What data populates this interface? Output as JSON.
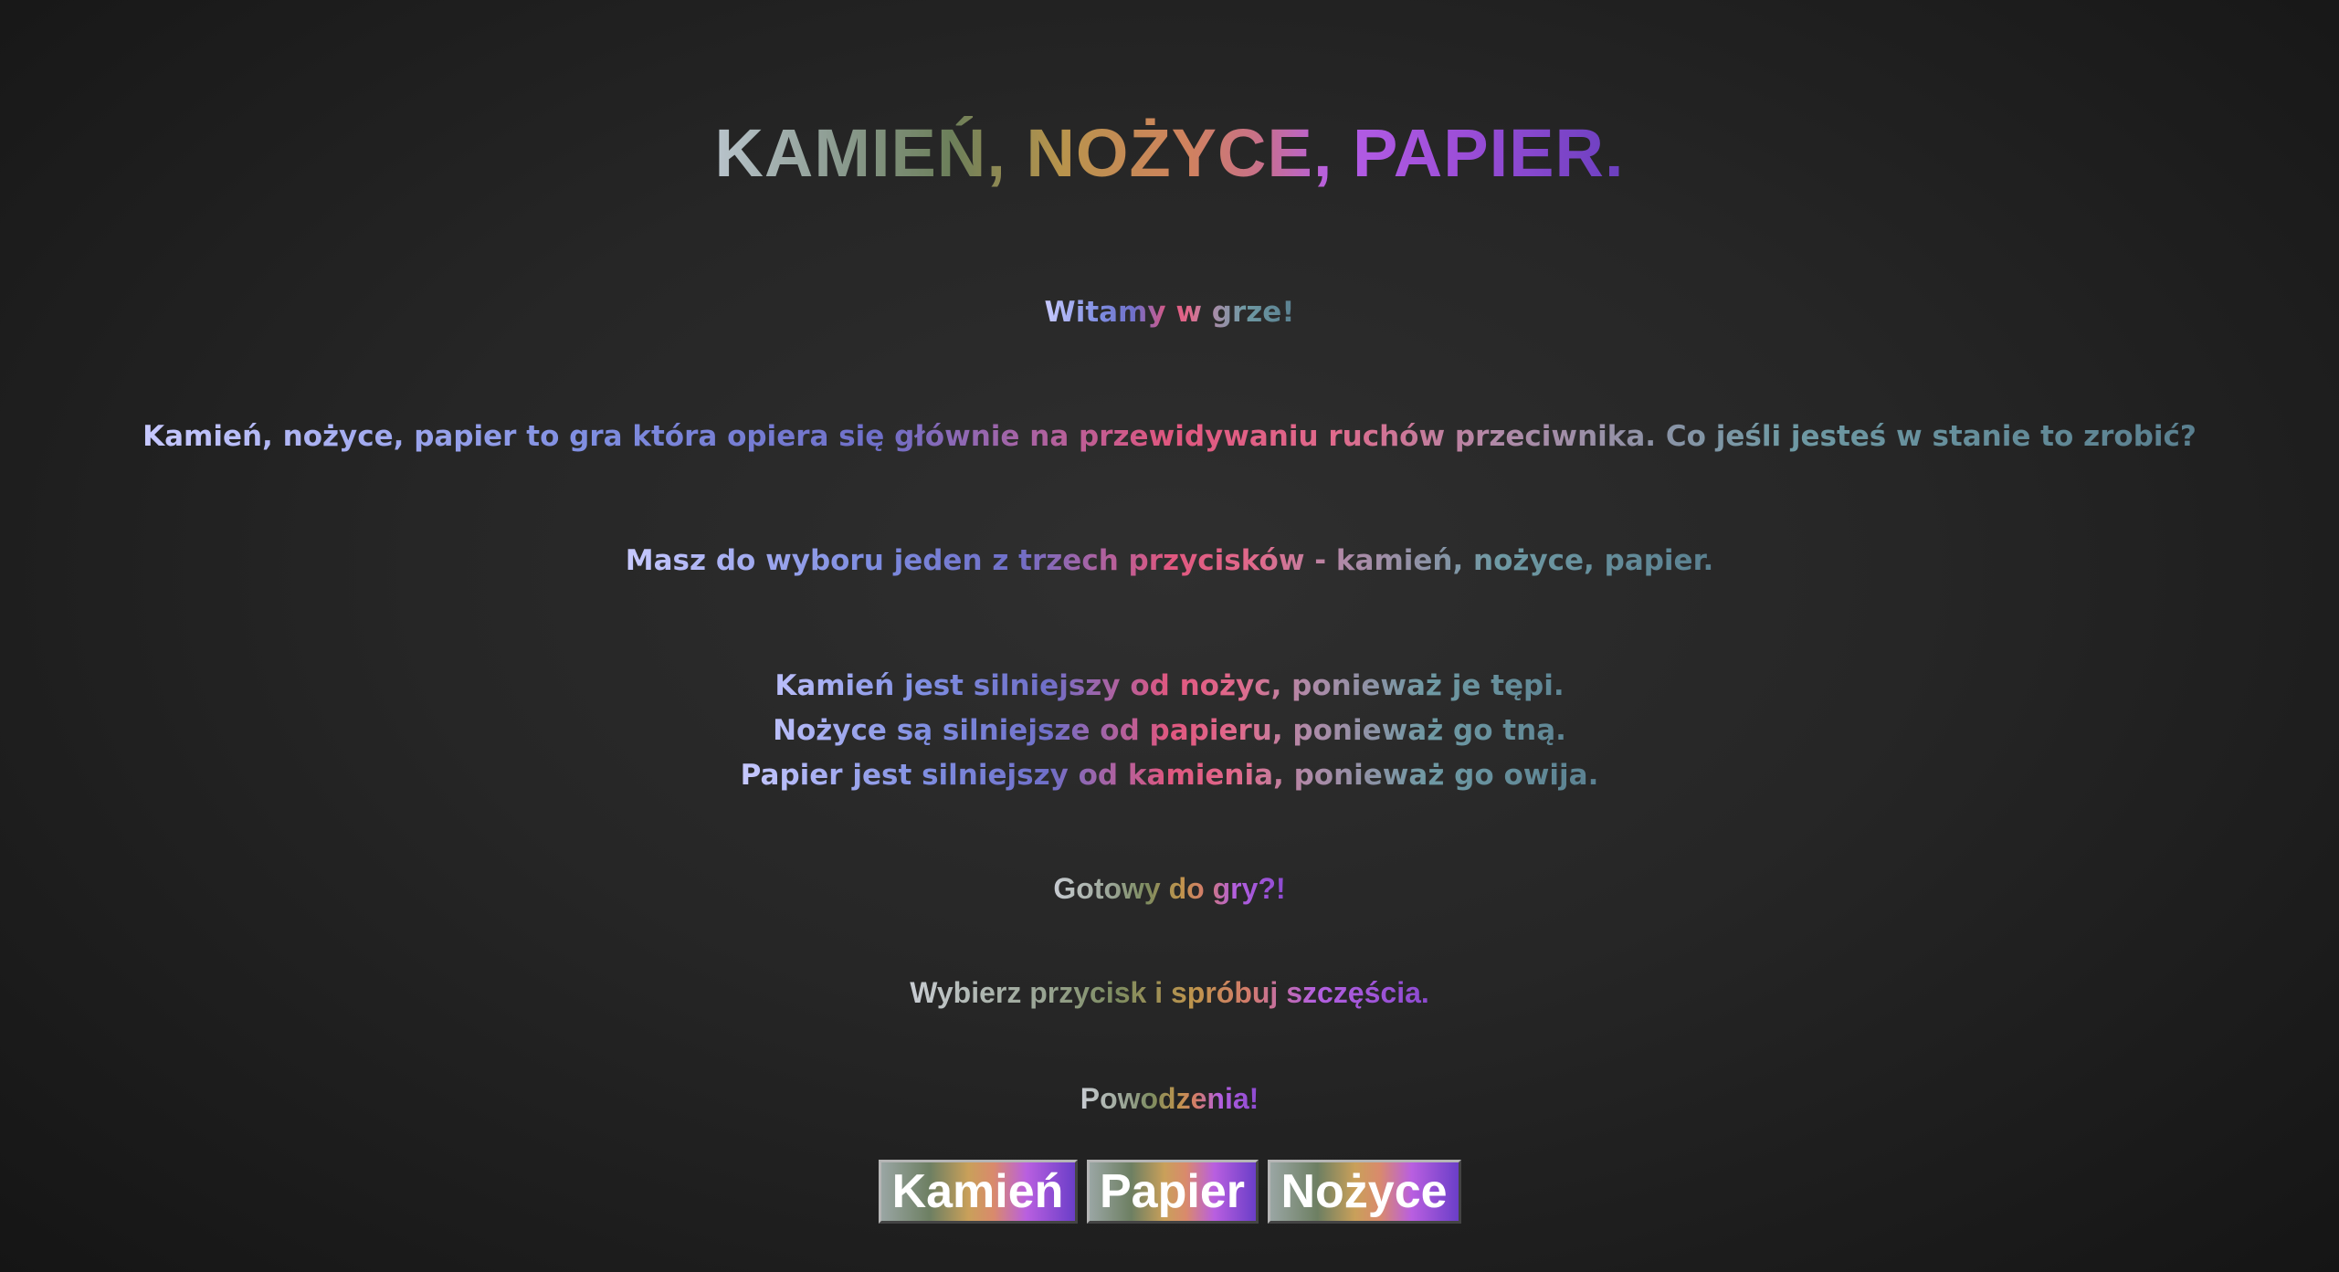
{
  "title": "KAMIEŃ, NOŻYCE, PAPIER.",
  "welcome": "Witamy w grze!",
  "intro": "Kamień, nożyce, papier to gra która opiera się głównie na przewidywaniu ruchów przeciwnika. Co jeśli jesteś w stanie to zrobić?",
  "choose": "Masz do wyboru jeden z trzech przycisków - kamień, nożyce, papier.",
  "rules": [
    "Kamień jest silniejszy od nożyc, ponieważ je tępi.",
    "Nożyce są silniejsze od papieru, ponieważ go tną.",
    "Papier jest silniejszy od kamienia, ponieważ go owija."
  ],
  "ready": "Gotowy do gry?!",
  "pick": "Wybierz przycisk i spróbuj szczęścia.",
  "luck": "Powodzenia!",
  "buttons": {
    "kamien": "Kamień",
    "papier": "Papier",
    "nozyce": "Nożyce"
  }
}
